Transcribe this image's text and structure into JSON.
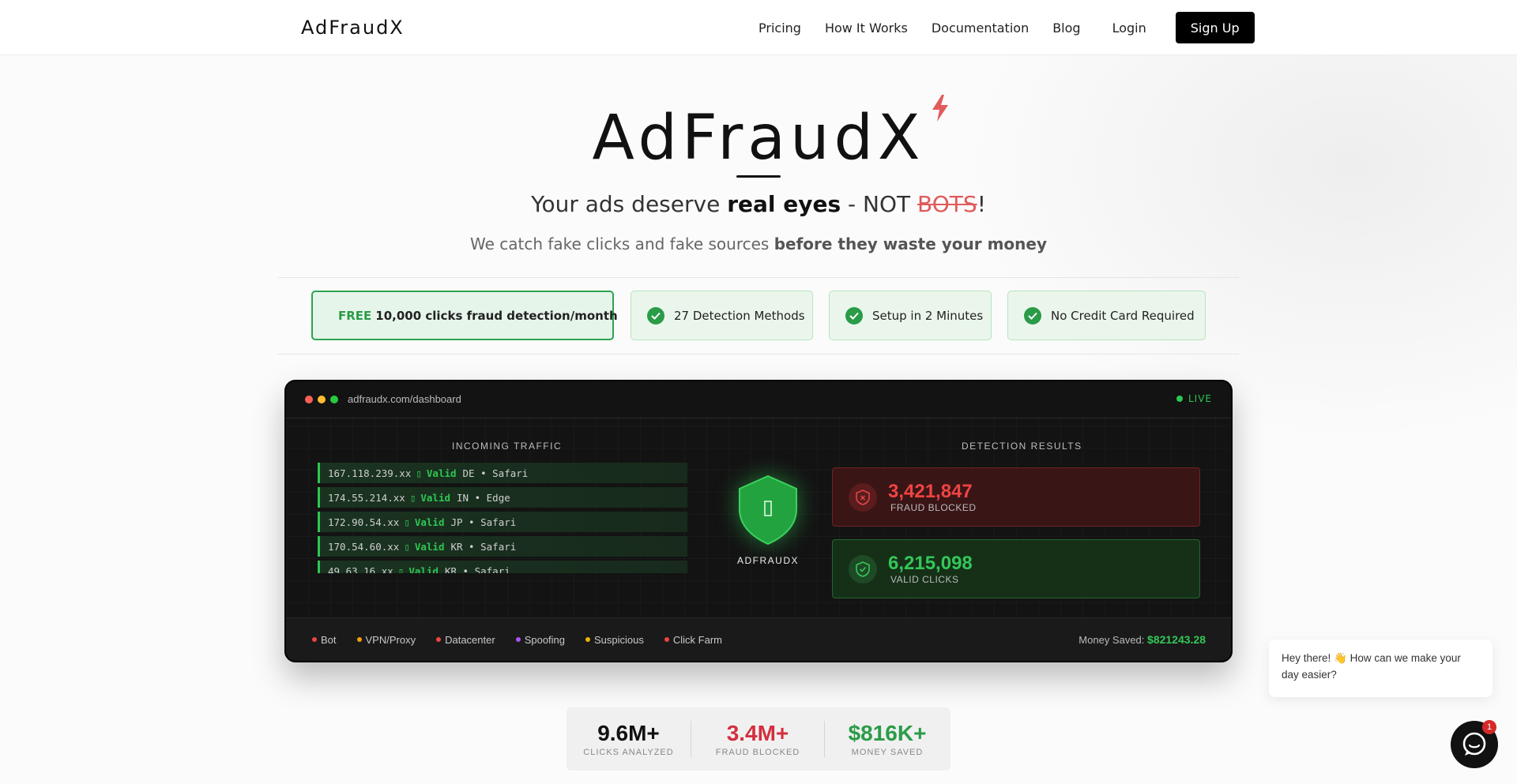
{
  "nav": {
    "logo": "AdFraudX",
    "links": [
      "Pricing",
      "How It Works",
      "Documentation",
      "Blog"
    ],
    "login": "Login",
    "signup": "Sign Up"
  },
  "hero": {
    "title": "AdFraudX",
    "tagline_start": "Your ads deserve ",
    "tagline_bold": "real eyes",
    "tagline_mid": " - NOT ",
    "tagline_strike": "BOTS",
    "tagline_end": "!",
    "sub_start": "We catch fake clicks and fake sources ",
    "sub_bold": "before they waste your money"
  },
  "features": {
    "free_word": "FREE",
    "free_text": "10,000 clicks fraud detection/month",
    "items": [
      "27 Detection Methods",
      "Setup in 2 Minutes",
      "No Credit Card Required"
    ],
    "icons": [
      "gift-icon",
      "check-circle-icon"
    ]
  },
  "dashboard": {
    "url": "adfraudx.com/dashboard",
    "live": "LIVE",
    "traffic_title": "INCOMING TRAFFIC",
    "results_title": "DETECTION RESULTS",
    "traffic": [
      {
        "ip": "167.118.239.xx",
        "status": "Valid",
        "info": "DE • Safari"
      },
      {
        "ip": "174.55.214.xx",
        "status": "Valid",
        "info": "IN • Edge"
      },
      {
        "ip": "172.90.54.xx",
        "status": "Valid",
        "info": "JP • Safari"
      },
      {
        "ip": "170.54.60.xx",
        "status": "Valid",
        "info": "KR • Safari"
      },
      {
        "ip": "49.63.16.xx",
        "status": "Valid",
        "info": "KR • Safari"
      }
    ],
    "shield_label": "ADFRAUDX",
    "fraud": {
      "value": "3,421,847",
      "label": "FRAUD BLOCKED"
    },
    "valid": {
      "value": "6,215,098",
      "label": "VALID CLICKS"
    },
    "legend": [
      {
        "label": "Bot",
        "color": "#ef4444"
      },
      {
        "label": "VPN/Proxy",
        "color": "#f59e0b"
      },
      {
        "label": "Datacenter",
        "color": "#ef4444"
      },
      {
        "label": "Spoofing",
        "color": "#a855f7"
      },
      {
        "label": "Suspicious",
        "color": "#eab308"
      },
      {
        "label": "Click Farm",
        "color": "#ef4444"
      }
    ],
    "money_saved_label": "Money Saved:",
    "money_saved_value": "$821243.28"
  },
  "stats": [
    {
      "value": "9.6M+",
      "label": "CLICKS ANALYZED",
      "color": "#111111"
    },
    {
      "value": "3.4M+",
      "label": "FRAUD BLOCKED",
      "color": "#d32f3f"
    },
    {
      "value": "$816K+",
      "label": "MONEY SAVED",
      "color": "#2a9b47"
    }
  ],
  "chat": {
    "message": "Hey there! 👋 How can we make your day easier?",
    "unread": "1"
  },
  "colors": {
    "accent_green": "#2a9b47",
    "accent_red": "#ef4444",
    "brand_dark": "#111111"
  }
}
